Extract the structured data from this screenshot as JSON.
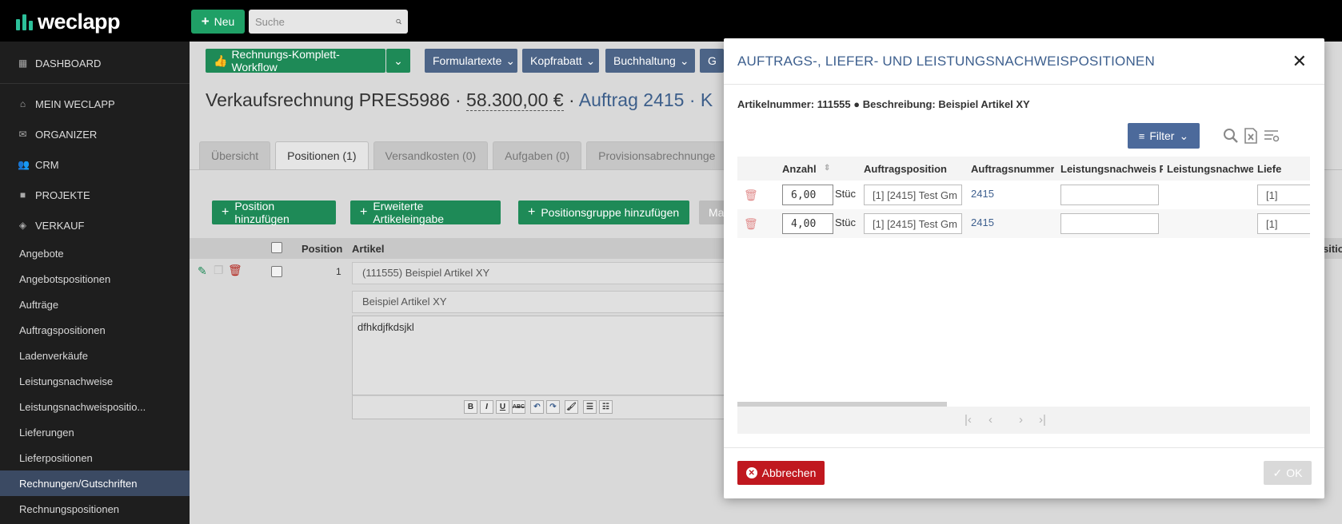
{
  "app": {
    "logo_text": "weclapp"
  },
  "header": {
    "new_label": "Neu",
    "search_placeholder": "Suche"
  },
  "sidebar": {
    "main_items": [
      {
        "label": "DASHBOARD",
        "icon": "dashboard-icon"
      },
      {
        "label": "MEIN WECLAPP",
        "icon": "home-icon"
      },
      {
        "label": "ORGANIZER",
        "icon": "mail-icon"
      },
      {
        "label": "CRM",
        "icon": "users-icon"
      },
      {
        "label": "PROJEKTE",
        "icon": "briefcase-icon"
      },
      {
        "label": "VERKAUF",
        "icon": "tag-icon"
      }
    ],
    "sub_items": [
      "Angebote",
      "Angebotspositionen",
      "Aufträge",
      "Auftragspositionen",
      "Ladenverkäufe",
      "Leistungsnachweise",
      "Leistungsnachweispositio...",
      "Lieferungen",
      "Lieferpositionen",
      "Rechnungen/Gutschriften",
      "Rechnungspositionen"
    ],
    "active_sub": "Rechnungen/Gutschriften"
  },
  "toolbar": {
    "workflow_label": "Rechnungs-Komplett-Workflow",
    "formulartexte_label": "Formulartexte",
    "kopfrabatt_label": "Kopfrabatt",
    "buchhaltung_label": "Buchhaltung",
    "extra_label": "G"
  },
  "page": {
    "title_prefix": "Verkaufsrechnung PRES5986 · ",
    "amount": "58.300,00 €",
    "title_sep": " · ",
    "order_link": "Auftrag 2415",
    "title_suffix": " · K"
  },
  "tabs": [
    {
      "label": "Übersicht",
      "active": false
    },
    {
      "label": "Positionen (1)",
      "active": true
    },
    {
      "label": "Versandkosten (0)",
      "active": false
    },
    {
      "label": "Aufgaben (0)",
      "active": false
    },
    {
      "label": "Provisionsabrechnunge",
      "active": false
    }
  ],
  "actions": {
    "add_position": "Position hinzufügen",
    "extended_entry": "Erweiterte Artikeleingabe",
    "add_group": "Positionsgruppe hinzufügen",
    "more": "Ma"
  },
  "positions_grid": {
    "col_position": "Position",
    "col_article": "Artikel",
    "right_cut": "sition",
    "row": {
      "position": "1",
      "article": "(111555) Beispiel Artikel XY",
      "description": "Beispiel Artikel XY",
      "text": "dfhkdjfkdsjkl"
    }
  },
  "editor_tools": [
    "B",
    "I",
    "U",
    "ABC",
    "↶",
    "↷",
    "🖌",
    "☰",
    "☷"
  ],
  "modal": {
    "title": "AUFTRAGS-, LIEFER- UND LEISTUNGSNACHWEISPOSITIONEN",
    "info": "Artikelnummer: 111555 ● Beschreibung: Beispiel Artikel XY",
    "filter_label": "Filter",
    "columns": {
      "anzahl": "Anzahl",
      "auftragsposition": "Auftragsposition",
      "auftragsnummer": "Auftragsnummer",
      "ln_pos": "Leistungsnachweis P",
      "ln_nr": "Leistungsnachwe",
      "liefer": "Liefe"
    },
    "rows": [
      {
        "anzahl": "6,00",
        "unit": "Stüc",
        "auftragsposition": "[1] [2415] Test Gm",
        "auftragsnummer": "2415",
        "ln_pos": "",
        "liefer": "[1]"
      },
      {
        "anzahl": "4,00",
        "unit": "Stüc",
        "auftragsposition": "[1] [2415] Test Gm",
        "auftragsnummer": "2415",
        "ln_pos": "",
        "liefer": "[1]"
      }
    ],
    "cancel_label": "Abbrechen",
    "ok_label": "OK"
  }
}
